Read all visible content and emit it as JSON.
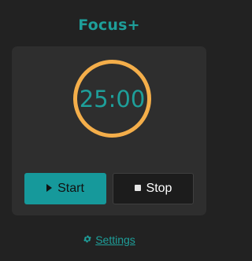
{
  "app": {
    "title": "Focus+"
  },
  "timer": {
    "display": "25:00",
    "ring_color": "#f4ae4a",
    "text_color": "#1e9f9a"
  },
  "controls": {
    "start": {
      "label": "Start",
      "icon": "play-icon",
      "color": "#16999b"
    },
    "stop": {
      "label": "Stop",
      "icon": "stop-icon"
    }
  },
  "footer": {
    "settings": {
      "label": "Settings",
      "icon": "gear-icon"
    }
  },
  "colors": {
    "background": "#222222",
    "card": "#2e2e2e",
    "accent": "#1e9f9a"
  }
}
